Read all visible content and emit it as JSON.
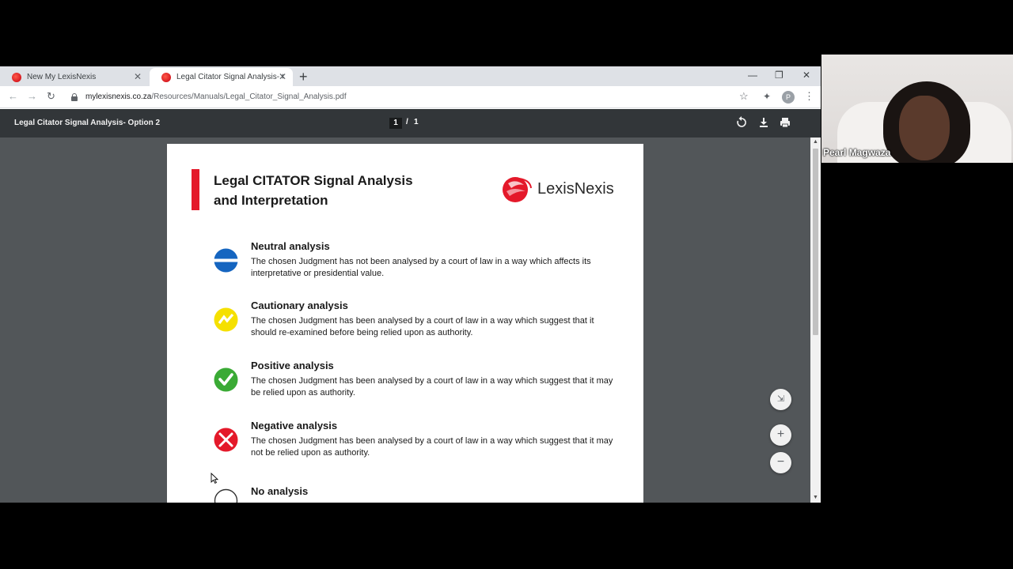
{
  "tabs": [
    {
      "title": "New My LexisNexis",
      "close": "✕"
    },
    {
      "title": "Legal Citator Signal Analysis- Op",
      "close": "✕"
    }
  ],
  "new_tab": "+",
  "window_controls": {
    "minimize": "—",
    "restore": "❐",
    "close": "✕"
  },
  "address": {
    "domain": "mylexisnexis.co.za",
    "path": "/Resources/Manuals/Legal_Citator_Signal_Analysis.pdf"
  },
  "profile_initial": "P",
  "pdf_viewer": {
    "title": "Legal Citator Signal Analysis- Option 2",
    "current_page": "1",
    "separator": "/",
    "total_pages": "1"
  },
  "document": {
    "title": "Legal CITATOR Signal Analysis and Interpretation",
    "logo_text": "LexisNexis",
    "items": [
      {
        "heading": "Neutral analysis",
        "description": "The chosen Judgment has not been analysed by a court of law in a way which affects its interpretative or presidential value.",
        "icon": "neutral-signal-icon",
        "color": "#1565c0"
      },
      {
        "heading": "Cautionary analysis",
        "description": "The chosen Judgment has been analysed by a court of law in a way which suggest that it should re-examined before being relied upon as authority.",
        "icon": "cautionary-signal-icon",
        "color": "#f5e000"
      },
      {
        "heading": "Positive analysis",
        "description": "The chosen Judgment has been analysed by a court of law in a way which suggest that it may be relied upon as authority.",
        "icon": "positive-signal-icon",
        "color": "#3aaa35"
      },
      {
        "heading": "Negative analysis",
        "description": "The chosen Judgment has been analysed by a court of law in a way which suggest that it may not be relied upon as authority.",
        "icon": "negative-signal-icon",
        "color": "#e4192a"
      },
      {
        "heading": "No analysis",
        "description": "",
        "icon": "no-analysis-signal-icon",
        "color": "#ffffff"
      }
    ]
  },
  "zoom": {
    "fit": "⇲",
    "zoom_in": "+",
    "zoom_out": "−"
  },
  "webcam": {
    "participant_name": "Pearl Magwaza"
  }
}
